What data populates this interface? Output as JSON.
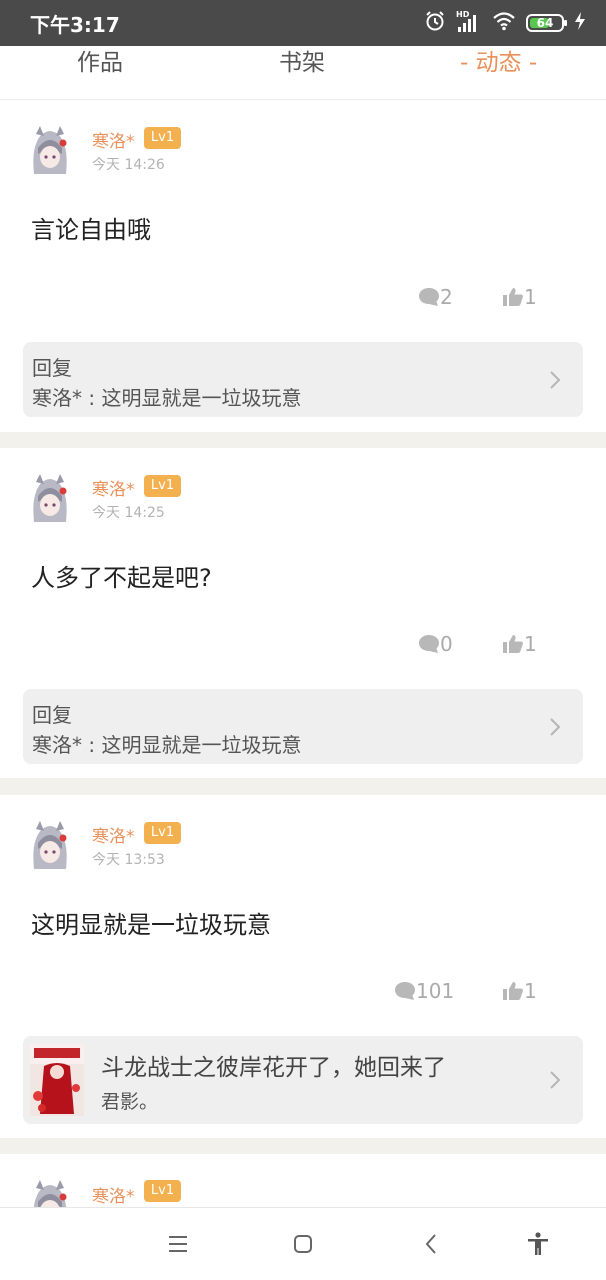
{
  "status_bar": {
    "time": "下午3:17",
    "hd_label": "HD",
    "battery_level": 64,
    "battery_text": "64"
  },
  "tabs": [
    {
      "label": "作品",
      "active": false
    },
    {
      "label": "书架",
      "active": false
    },
    {
      "label": "- 动态 -",
      "active": true
    }
  ],
  "posts": [
    {
      "user": "寒洛*",
      "level": "Lv1",
      "time": "今天 14:26",
      "content": "言论自由哦",
      "comments": "2",
      "likes": "1",
      "reply": {
        "title": "回复",
        "text": "寒洛* : 这明显就是一垃圾玩意"
      }
    },
    {
      "user": "寒洛*",
      "level": "Lv1",
      "time": "今天 14:25",
      "content": "人多了不起是吧?",
      "comments": "0",
      "likes": "1",
      "reply": {
        "title": "回复",
        "text": "寒洛* : 这明显就是一垃圾玩意"
      }
    },
    {
      "user": "寒洛*",
      "level": "Lv1",
      "time": "今天 13:53",
      "content": "这明显就是一垃圾玩意",
      "comments": "101",
      "likes": "1",
      "book": {
        "title": "斗龙战士之彼岸花开了，她回来了",
        "author": "君影。"
      }
    },
    {
      "user": "寒洛*",
      "level": "Lv1"
    }
  ],
  "colors": {
    "accent": "#e8915b",
    "badge": "#f2b04f",
    "status_bar": "#4a4a4a",
    "divider": "#f3f1ec",
    "battery": "#57c84d"
  },
  "icons": [
    "alarm-icon",
    "signal-icon",
    "wifi-icon",
    "battery-icon",
    "charging-icon",
    "comment-icon",
    "like-icon",
    "chevron-right-icon",
    "menu-icon",
    "home-icon",
    "back-icon",
    "accessibility-icon"
  ]
}
